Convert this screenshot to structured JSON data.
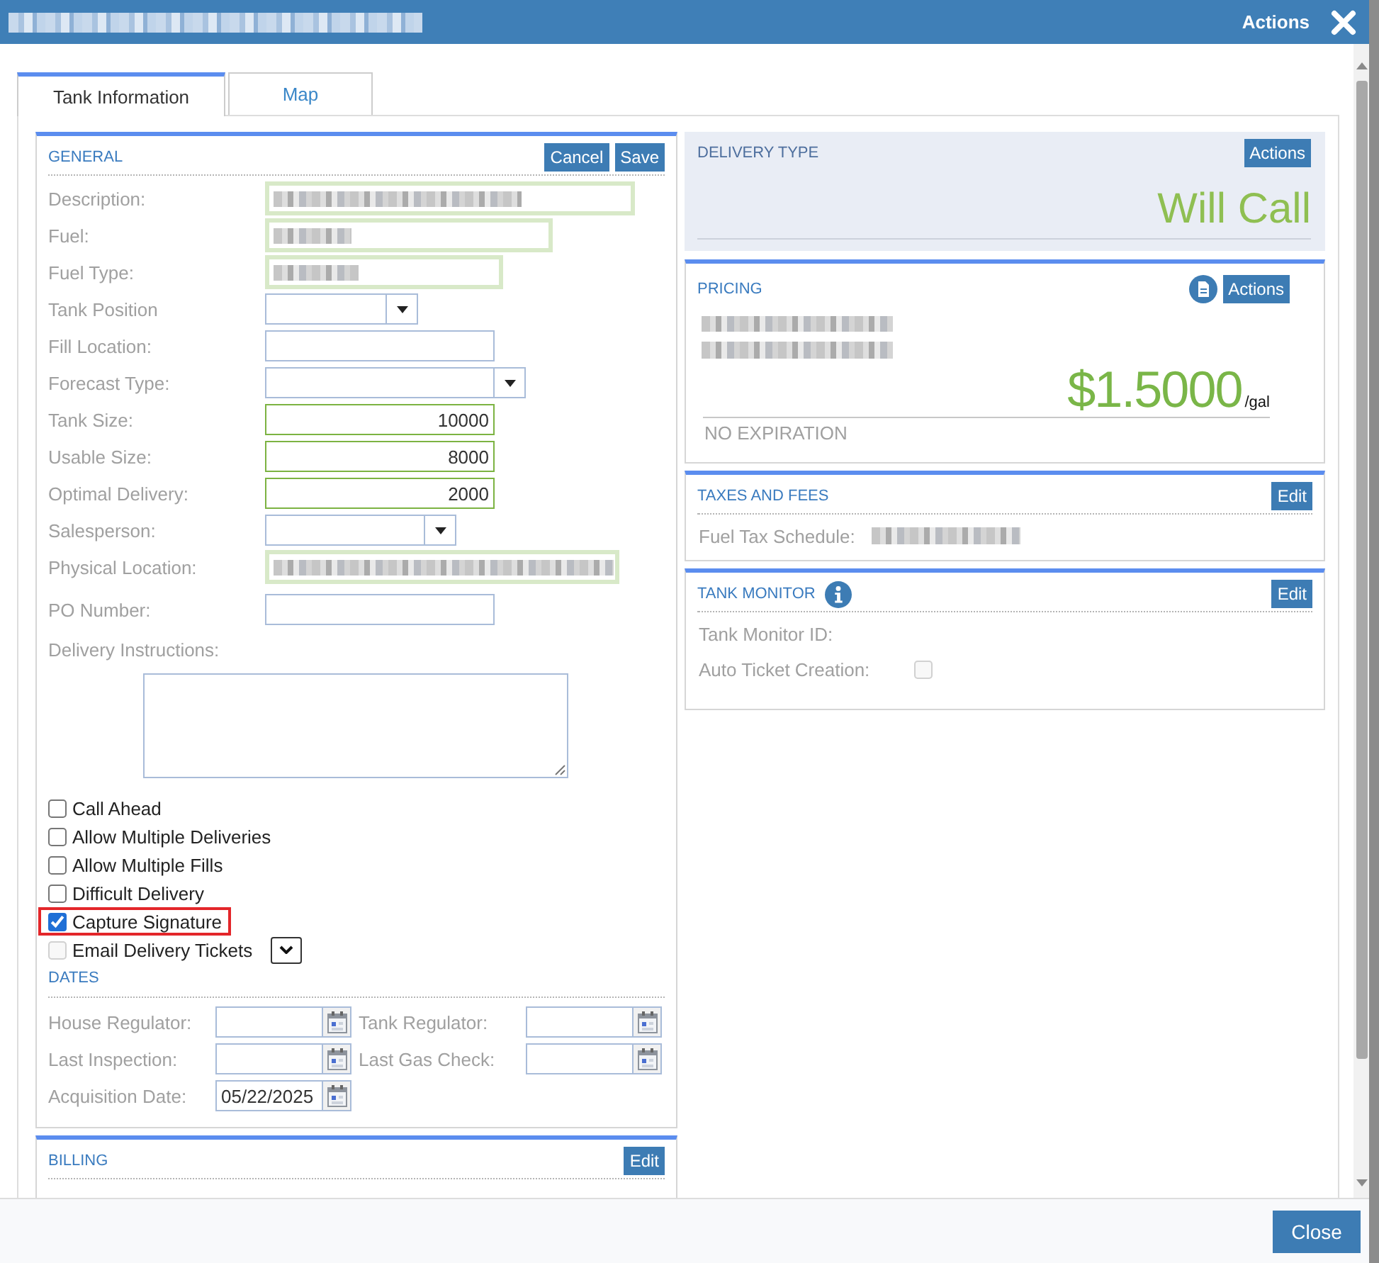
{
  "window": {
    "title_obscured": true,
    "actions": "Actions"
  },
  "tabs": [
    {
      "label": "Tank Information",
      "selected": true
    },
    {
      "label": "Map",
      "selected": false
    }
  ],
  "general": {
    "title": "GENERAL",
    "buttons": [
      "Cancel",
      "Save"
    ],
    "fields": [
      {
        "label": "Description:",
        "kind": "input",
        "valid": true,
        "obscured": true
      },
      {
        "label": "Fuel:",
        "kind": "select",
        "valid": true,
        "obscured": true
      },
      {
        "label": "Fuel Type:",
        "kind": "select",
        "valid": true,
        "obscured": true
      },
      {
        "label": "Tank Position",
        "kind": "select",
        "valid": false,
        "obscured": false
      },
      {
        "label": "Fill Location:",
        "kind": "input",
        "valid": false,
        "obscured": false
      },
      {
        "label": "Forecast Type:",
        "kind": "select",
        "valid": false,
        "obscured": false
      },
      {
        "label": "Tank Size:",
        "kind": "number",
        "valid": true,
        "obscured": false,
        "value": "10000"
      },
      {
        "label": "Usable Size:",
        "kind": "number",
        "valid": true,
        "obscured": false,
        "value": "8000"
      },
      {
        "label": "Optimal Delivery:",
        "kind": "number",
        "valid": true,
        "obscured": false,
        "value": "2000"
      },
      {
        "label": "Salesperson:",
        "kind": "select",
        "valid": false,
        "obscured": false
      },
      {
        "label": "Physical Location:",
        "kind": "input",
        "valid": true,
        "obscured": true
      },
      {
        "label": "PO Number:",
        "kind": "input",
        "valid": false,
        "obscured": false
      }
    ],
    "instructions": {
      "label": "Delivery Instructions:"
    },
    "options": [
      {
        "label": "Call Ahead",
        "kind": "checkbox",
        "checked": false,
        "disabled": false,
        "highlighted": false
      },
      {
        "label": "Allow Multiple Deliveries",
        "kind": "checkbox",
        "checked": false,
        "disabled": false,
        "highlighted": false
      },
      {
        "label": "Allow Multiple Fills",
        "kind": "checkbox",
        "checked": false,
        "disabled": false,
        "highlighted": false
      },
      {
        "label": "Difficult Delivery",
        "kind": "checkbox",
        "checked": false,
        "disabled": false,
        "highlighted": false
      },
      {
        "label": "Capture Signature",
        "kind": "checkbox",
        "checked": true,
        "disabled": false,
        "highlighted": true
      },
      {
        "label": "Email Delivery Tickets",
        "kind": "checkbox-menu",
        "checked": false,
        "disabled": true,
        "highlighted": false
      }
    ],
    "dates": {
      "title": "DATES",
      "fields": [
        {
          "label": "House Regulator:"
        },
        {
          "label": "Tank Regulator:"
        },
        {
          "label": "Last Inspection:"
        },
        {
          "label": "Last Gas Check:"
        },
        {
          "label": "Acquisition Date:",
          "value": "05/22/2025"
        }
      ]
    }
  },
  "billing": {
    "title": "BILLING",
    "button": "Edit"
  },
  "delivery_type": {
    "title": "DELIVERY TYPE",
    "button": "Actions",
    "value": "Will Call"
  },
  "pricing": {
    "title": "PRICING",
    "button": "Actions",
    "details_obscured": true,
    "price": "$1.5000",
    "unit": "/gal",
    "expiration": "NO EXPIRATION"
  },
  "taxes_and_fees": {
    "title": "TAXES AND FEES",
    "button": "Edit",
    "fields": [
      {
        "label": "Fuel Tax Schedule:",
        "obscured": true
      }
    ]
  },
  "tank_monitor": {
    "title": "TANK MONITOR",
    "button": "Edit",
    "fields": [
      {
        "label": "Tank Monitor ID:",
        "kind": "text"
      },
      {
        "label": "Auto Ticket Creation:",
        "kind": "checkbox",
        "checked": false,
        "disabled": true
      }
    ]
  },
  "footer": {
    "button": "Close"
  }
}
